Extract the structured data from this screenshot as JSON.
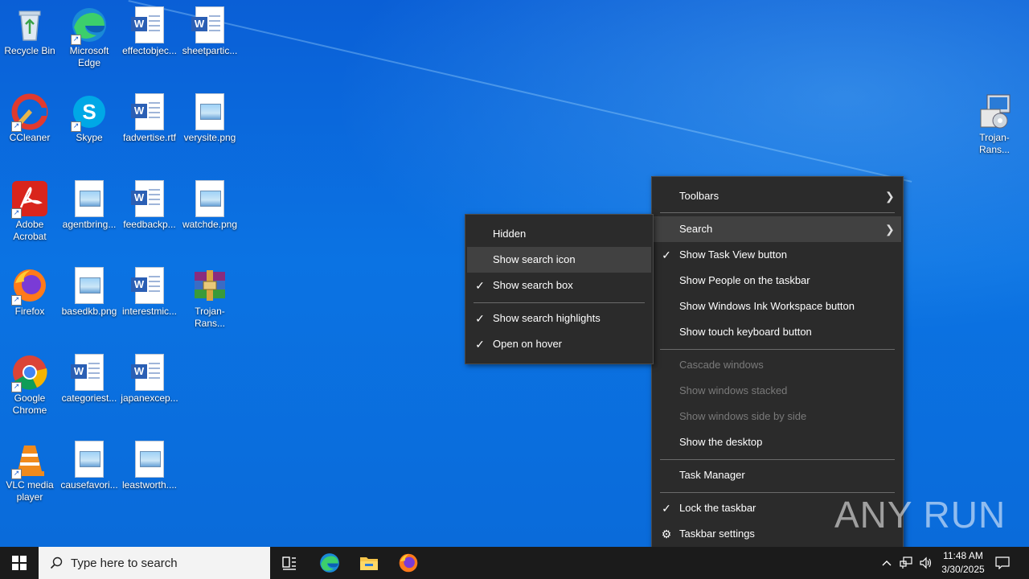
{
  "desktop": {
    "icons": [
      {
        "label": "Recycle Bin",
        "icon": "recycle-bin-icon"
      },
      {
        "label": "Microsoft Edge",
        "icon": "edge-icon"
      },
      {
        "label": "effectobjec...",
        "icon": "word-doc-icon"
      },
      {
        "label": "sheetpartic...",
        "icon": "word-doc-icon"
      },
      {
        "label": "CCleaner",
        "icon": "ccleaner-icon"
      },
      {
        "label": "Skype",
        "icon": "skype-icon"
      },
      {
        "label": "fadvertise.rtf",
        "icon": "word-doc-icon"
      },
      {
        "label": "verysite.png",
        "icon": "image-file-icon"
      },
      {
        "label": "Adobe Acrobat",
        "icon": "acrobat-icon"
      },
      {
        "label": "agentbring...",
        "icon": "image-file-icon"
      },
      {
        "label": "feedbackp...",
        "icon": "word-doc-icon"
      },
      {
        "label": "watchde.png",
        "icon": "image-file-icon"
      },
      {
        "label": "Firefox",
        "icon": "firefox-icon"
      },
      {
        "label": "basedkb.png",
        "icon": "image-file-icon"
      },
      {
        "label": "interestmic...",
        "icon": "word-doc-icon"
      },
      {
        "label": "Trojan-Rans...",
        "icon": "winrar-archive-icon"
      },
      {
        "label": "Google Chrome",
        "icon": "chrome-icon"
      },
      {
        "label": "categoriest...",
        "icon": "word-doc-icon"
      },
      {
        "label": "japanexcep...",
        "icon": "word-doc-icon"
      },
      {
        "label": "VLC media player",
        "icon": "vlc-icon"
      },
      {
        "label": "causefavori...",
        "icon": "image-file-icon"
      },
      {
        "label": "leastworth....",
        "icon": "image-file-icon"
      },
      {
        "label": "Trojan-Rans...",
        "icon": "installer-icon"
      }
    ]
  },
  "taskbar": {
    "search_placeholder": "Type here to search",
    "time": "11:48 AM",
    "date": "3/30/2025"
  },
  "taskbar_menu": {
    "items": {
      "toolbars": "Toolbars",
      "search": "Search",
      "show_task_view": "Show Task View button",
      "show_people": "Show People on the taskbar",
      "show_ink": "Show Windows Ink Workspace button",
      "show_touch_keyboard": "Show touch keyboard button",
      "cascade": "Cascade windows",
      "stacked": "Show windows stacked",
      "side_by_side": "Show windows side by side",
      "show_desktop": "Show the desktop",
      "task_manager": "Task Manager",
      "lock_taskbar": "Lock the taskbar",
      "taskbar_settings": "Taskbar settings"
    }
  },
  "search_submenu": {
    "items": {
      "hidden": "Hidden",
      "show_search_icon": "Show search icon",
      "show_search_box": "Show search box",
      "show_search_highlights": "Show search highlights",
      "open_on_hover": "Open on hover"
    }
  },
  "watermark": {
    "text": "ANY RUN"
  }
}
